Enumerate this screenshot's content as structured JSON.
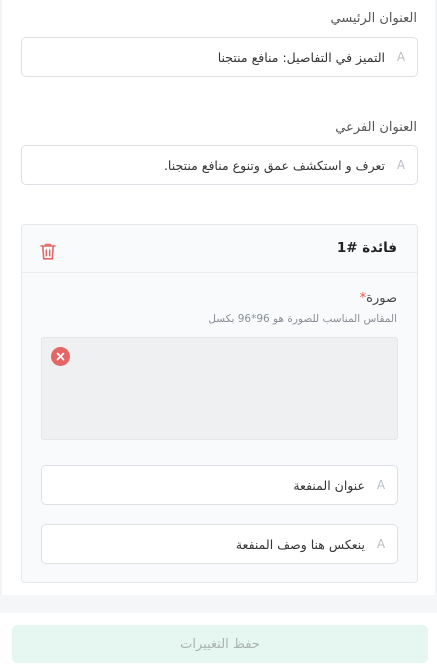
{
  "main_title": {
    "label": "العنوان الرئيسي",
    "value": "التميز في التفاصيل: منافع منتجنا"
  },
  "subtitle": {
    "label": "العنوان الفرعي",
    "value": "تعرف و استكشف عمق وتنوع منافع منتجنا."
  },
  "benefit": {
    "title": "فائدة #1",
    "image_label": "صورة",
    "required_mark": "*",
    "image_hint": "المقاس المناسب للصورة هو 96*96 بكسل",
    "title_placeholder": "عنوان المنفعة",
    "desc_placeholder": "ينعكس هنا وصف المنفعة"
  },
  "footer": {
    "save_label": "حفظ التغييرات"
  },
  "icons": {
    "text_field": "A",
    "delete": "trash-icon",
    "remove_image": "close-icon"
  },
  "colors": {
    "danger": "#e46767",
    "save_bg": "#e6f6f1",
    "card_bg": "#f9fafb"
  }
}
